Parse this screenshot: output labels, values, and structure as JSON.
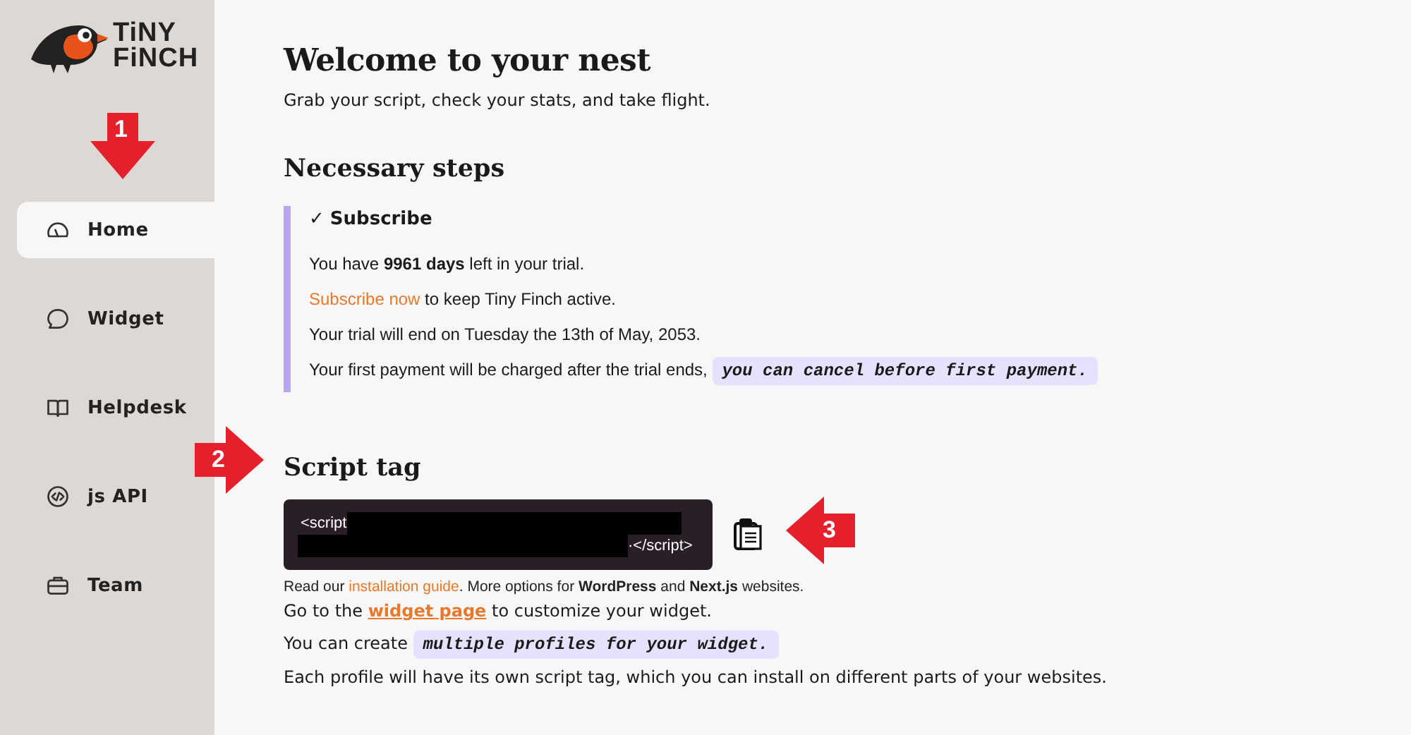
{
  "brand": {
    "line_1": "TiNY",
    "line_2": "FiNCH"
  },
  "nav": [
    {
      "label": "Home",
      "selected": true
    },
    {
      "label": "Widget",
      "selected": false
    },
    {
      "label": "Helpdesk",
      "selected": false
    },
    {
      "label": "js API",
      "selected": false
    },
    {
      "label": "Team",
      "selected": false
    }
  ],
  "header": {
    "title": "Welcome to your nest",
    "subtitle": "Grab your script, check your stats, and take flight."
  },
  "steps": {
    "heading": "Necessary steps",
    "item": {
      "check": "✓",
      "title": "Subscribe",
      "done": true,
      "lines": [
        [
          {
            "kind": "plain",
            "text": "You have **9961 days** left in your trial."
          }
        ],
        [
          {
            "kind": "link",
            "text": "Subscribe now"
          },
          {
            "kind": "plain",
            "text": " to keep Tiny Finch active."
          }
        ],
        [
          {
            "kind": "plain",
            "text": "Your trial will end on Tuesday the 13th of May, 2053."
          }
        ],
        [
          {
            "kind": "plain",
            "text": "Your first payment will be charged after the trial ends, "
          },
          {
            "kind": "code",
            "text": "you can cancel before first payment."
          }
        ]
      ]
    }
  },
  "script": {
    "heading": "Script tag",
    "code_start": "<script",
    "code_end": "·</script>",
    "note": [
      {
        "kind": "plain",
        "text": "Read our "
      },
      {
        "kind": "link",
        "text": "installation guide"
      },
      {
        "kind": "plain",
        "text": ". More options for **WordPress** and **Next.js** websites."
      }
    ],
    "lines": [
      [
        {
          "kind": "plain",
          "text": "Go to the "
        },
        {
          "kind": "strong_link",
          "text": "widget page"
        },
        {
          "kind": "plain",
          "text": " to customize your widget."
        }
      ],
      [
        {
          "kind": "plain",
          "text": "You can create "
        },
        {
          "kind": "code",
          "text": "multiple profiles for your widget."
        }
      ],
      [
        {
          "kind": "plain",
          "text": "Each profile will have its own script tag, which you can install on different parts of your websites."
        }
      ]
    ]
  },
  "annotations": [
    {
      "number": "1",
      "kind": "down"
    },
    {
      "number": "2",
      "kind": "right"
    },
    {
      "number": "3",
      "kind": "left"
    }
  ]
}
